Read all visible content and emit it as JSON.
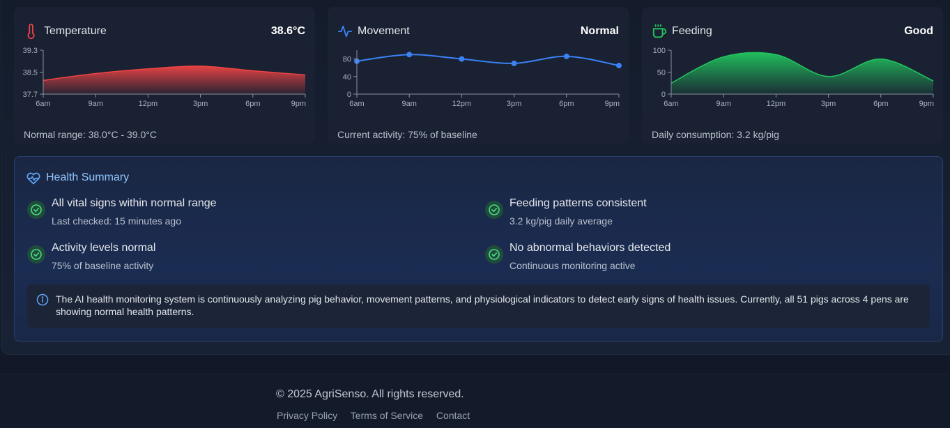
{
  "cards": [
    {
      "title": "Temperature",
      "value": "38.6°C",
      "footer": "Normal range: 38.0°C - 39.0°C",
      "icon": "thermometer-icon",
      "color": "#ef4444"
    },
    {
      "title": "Movement",
      "value": "Normal",
      "footer": "Current activity: 75% of baseline",
      "icon": "activity-icon",
      "color": "#3b82f6"
    },
    {
      "title": "Feeding",
      "value": "Good",
      "footer": "Daily consumption: 3.2 kg/pig",
      "icon": "coffee-cup-icon",
      "color": "#22c55e"
    }
  ],
  "chart_data": [
    {
      "type": "area",
      "x": [
        "6am",
        "9am",
        "12pm",
        "3pm",
        "6pm",
        "9pm"
      ],
      "yticks": [
        "37.7",
        "38.5",
        "39.3"
      ],
      "ylim": [
        37.7,
        39.3
      ],
      "series": [
        {
          "values": [
            38.2,
            38.45,
            38.62,
            38.72,
            38.55,
            38.4
          ]
        }
      ],
      "color": "#ef4444"
    },
    {
      "type": "line",
      "x": [
        "6am",
        "9am",
        "12pm",
        "3pm",
        "6pm",
        "9pm"
      ],
      "yticks": [
        "0",
        "40",
        "80"
      ],
      "ylim": [
        0,
        100
      ],
      "series": [
        {
          "values": [
            75,
            90,
            80,
            70,
            86,
            65
          ]
        }
      ],
      "color": "#3b82f6"
    },
    {
      "type": "area",
      "x": [
        "6am",
        "9am",
        "12pm",
        "3pm",
        "6pm",
        "9pm"
      ],
      "yticks": [
        "0",
        "50",
        "100"
      ],
      "ylim": [
        0,
        100
      ],
      "series": [
        {
          "values": [
            25,
            85,
            90,
            40,
            80,
            30
          ]
        }
      ],
      "color": "#22c55e"
    }
  ],
  "summary": {
    "title": "Health Summary",
    "items": [
      {
        "title": "All vital signs within normal range",
        "subtitle": "Last checked: 15 minutes ago"
      },
      {
        "title": "Feeding patterns consistent",
        "subtitle": "3.2 kg/pig daily average"
      },
      {
        "title": "Activity levels normal",
        "subtitle": "75% of baseline activity"
      },
      {
        "title": "No abnormal behaviors detected",
        "subtitle": "Continuous monitoring active"
      }
    ],
    "info": "The AI health monitoring system is continuously analyzing pig behavior, movement patterns, and physiological indicators to detect early signs of health issues. Currently, all 51 pigs across 4 pens are showing normal health patterns."
  },
  "footer": {
    "copyright": "© 2025 AgriSenso. All rights reserved.",
    "links": [
      "Privacy Policy",
      "Terms of Service",
      "Contact"
    ]
  }
}
